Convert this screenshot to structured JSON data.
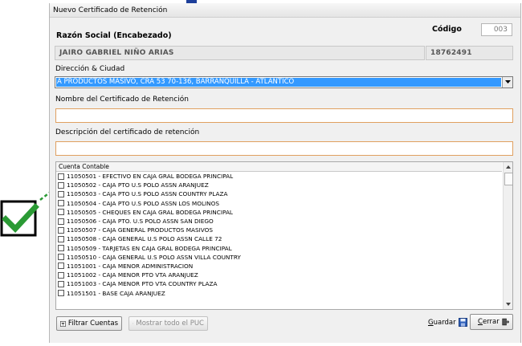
{
  "window": {
    "title": "Nuevo Certificado de Retención"
  },
  "form": {
    "codigo_label": "Código",
    "codigo_value": "003",
    "razon_social_label": "Razón Social (Encabezado)",
    "razon_social_value": "JAIRO GABRIEL NIÑO ARIAS",
    "nit_value": "18762491",
    "direccion_label": "Dirección & Ciudad",
    "direccion_selected": "A PRODUCTOS MASIVO, CRA 53 70-136, BARRANQUILLA - ATLÁNTICO",
    "nombre_label": "Nombre del Certificado de Retención",
    "nombre_value": "",
    "descripcion_label": "Descripción del certificado de retención",
    "descripcion_value": ""
  },
  "accounts": {
    "header": "Cuenta Contable",
    "items": [
      "11050501 - EFECTIVO EN CAJA GRAL BODEGA PRINCIPAL",
      "11050502 - CAJA PTO U.S POLO ASSN ARANJUEZ",
      "11050503 - CAJA PTO U.S POLO ASSN COUNTRY PLAZA",
      "11050504 - CAJA PTO U.S POLO ASSN LOS MOLINOS",
      "11050505 - CHEQUES EN CAJA GRAL BODEGA PRINCIPAL",
      "11050506 - CAJA PTO. U.S POLO ASSN SAN DIEGO",
      "11050507 - CAJA GENERAL PRODUCTOS MASIVOS",
      "11050508 - CAJA GENERAL U.S POLO ASSN CALLE 72",
      "11050509 - TARJETAS EN CAJA GRAL BODEGA PRINCIPAL",
      "11050510 - CAJA GENERAL U.S POLO ASSN VILLA COUNTRY",
      "11051001 - CAJA MENOR ADMINISTRACION",
      "11051002 - CAJA MENOR PTO VTA ARANJUEZ",
      "11051003 - CAJA MENOR PTO VTA COUNTRY PLAZA",
      "11051501 - BASE CAJA ARANJUEZ"
    ]
  },
  "buttons": {
    "filtrar": "Filtrar Cuentas",
    "mostrar": "Mostrar todo el PUC",
    "guardar": "Guardar",
    "cerrar": "Cerrar"
  },
  "colors": {
    "selection": "#3399ff",
    "input_border": "#e0a060",
    "checkmark": "#2a9a34"
  }
}
